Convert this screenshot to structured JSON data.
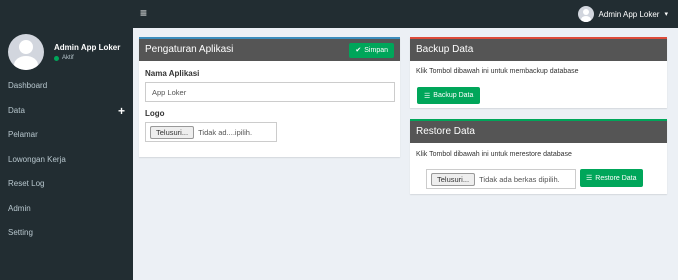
{
  "topbar": {
    "toggle_icon": "≡",
    "user_name": "Admin App Loker",
    "caret": "▾"
  },
  "sidebar": {
    "user_name": "Admin App Loker",
    "user_status": "Aktif",
    "status_color": "#00a65a",
    "items": [
      {
        "label": "Dashboard"
      },
      {
        "label": "Data",
        "plus": "+"
      },
      {
        "label": "Pelamar"
      },
      {
        "label": "Lowongan Kerja"
      },
      {
        "label": "Reset Log"
      },
      {
        "label": "Admin"
      },
      {
        "label": "Setting"
      }
    ]
  },
  "settings_panel": {
    "title": "Pengaturan Aplikasi",
    "save_label": "Simpan",
    "app_name_label": "Nama Aplikasi",
    "app_name_value": "App Loker",
    "logo_label": "Logo",
    "browse_label": "Telusuri...",
    "file_status": "Tidak ad....ipilih."
  },
  "backup_panel": {
    "title": "Backup Data",
    "description": "Klik Tombol dibawah ini untuk membackup database",
    "button_label": "Backup Data"
  },
  "restore_panel": {
    "title": "Restore Data",
    "description": "Klik Tombol dibawah ini untuk merestore database",
    "browse_label": "Telusuri...",
    "file_status": "Tidak ada berkas dipilih.",
    "button_label": "Restore Data"
  },
  "colors": {
    "accent_blue": "#3c8dbc",
    "accent_red": "#dd4b39",
    "accent_green": "#00a65a",
    "sidebar_bg": "#222d32"
  }
}
